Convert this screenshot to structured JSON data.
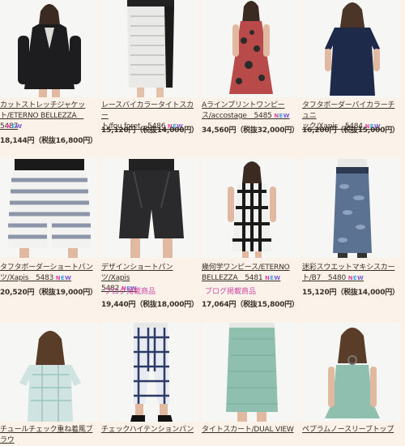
{
  "new_label": [
    "N",
    "E",
    "W"
  ],
  "items": [
    {
      "name1": "カットストレッチジャケッ",
      "name2": "ト/ETERNO BELLEZZA　5487",
      "price": "18,144円（税抜16,800円）",
      "blog": ""
    },
    {
      "name1": "レースバイカラータイトスカー",
      "name2": "ト/fou foret　5486",
      "price": "15,120円（税抜14,000円）",
      "blog": ""
    },
    {
      "name1": "Aラインプリントワンピー",
      "name2": "ス/accostage　5485",
      "price": "34,560円（税抜32,000円）",
      "blog": ""
    },
    {
      "name1": "タフタボーダーバイカラーチュニ",
      "name2": "ック/Xapis　5484",
      "price": "16,200円（税抜15,000円）",
      "blog": ""
    },
    {
      "name1": "タフタボーダーショートパン",
      "name2": "ツ/Xapis　5483",
      "price": "20,520円（税抜19,000円）",
      "blog": ""
    },
    {
      "name1": "デザインショートパンツ/Xapis",
      "name2": "5482",
      "price": "19,440円（税抜18,000円）",
      "blog": "ブログ掲載商品"
    },
    {
      "name1": "幾何学ワンピース/ETERNO",
      "name2": "BELLEZZA　5481",
      "price": "17,064円（税抜15,800円）",
      "blog": "ブログ掲載商品"
    },
    {
      "name1": "迷彩スウエットマキシスカー",
      "name2": "ト/B7　5480",
      "price": "15,120円（税抜14,000円）",
      "blog": ""
    },
    {
      "name1": "チュールチェック重ね着風ブラウ",
      "name2": "",
      "price": "",
      "blog": ""
    },
    {
      "name1": "チェックハイテンションパン",
      "name2": "",
      "price": "",
      "blog": ""
    },
    {
      "name1": "タイトスカート/DUAL VIEW",
      "name2": "",
      "price": "",
      "blog": ""
    },
    {
      "name1": "ペプラムノースリーブトップ",
      "name2": "",
      "price": "",
      "blog": ""
    }
  ]
}
